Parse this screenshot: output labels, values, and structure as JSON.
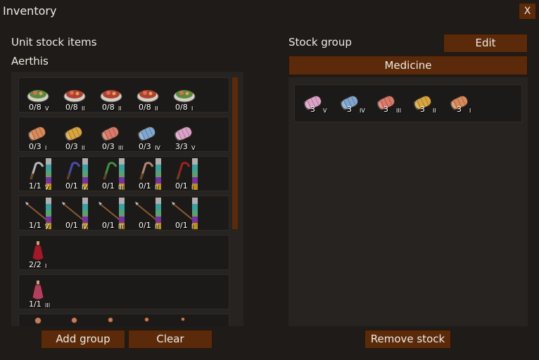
{
  "window": {
    "title": "Inventory",
    "close_label": "X"
  },
  "left": {
    "heading": "Unit stock items",
    "unit_name": "Aerthis",
    "rows": [
      {
        "kind": "food",
        "items": [
          {
            "icon": "salad-bowl-icon",
            "qty": "0/8",
            "rank": "V"
          },
          {
            "icon": "meat-bowl-icon",
            "qty": "0/8",
            "rank": "II"
          },
          {
            "icon": "meat-plate-icon",
            "qty": "0/8",
            "rank": "II"
          },
          {
            "icon": "meat-dish-icon",
            "qty": "0/8",
            "rank": "II"
          },
          {
            "icon": "salad-bowl-icon",
            "qty": "0/8",
            "rank": "I"
          }
        ]
      },
      {
        "kind": "bandage",
        "items": [
          {
            "icon": "bandage-roll-icon",
            "color": "#d98a5a",
            "qty": "0/3",
            "rank": "I"
          },
          {
            "icon": "bandage-roll-icon",
            "color": "#d8a640",
            "qty": "0/3",
            "rank": "II"
          },
          {
            "icon": "bandage-roll-icon",
            "color": "#d97a6a",
            "qty": "0/3",
            "rank": "III"
          },
          {
            "icon": "bandage-roll-icon",
            "color": "#7fa8d0",
            "qty": "0/3",
            "rank": "IV"
          },
          {
            "icon": "bandage-roll-icon",
            "color": "#dba2c8",
            "qty": "3/3",
            "rank": "V"
          }
        ]
      },
      {
        "kind": "sickle",
        "items": [
          {
            "icon": "sickle-icon",
            "color": "#b9b9b9",
            "qty": "1/1",
            "rank": "V"
          },
          {
            "icon": "sickle-icon",
            "color": "#4a4ab0",
            "qty": "0/1",
            "rank": "IV"
          },
          {
            "icon": "sickle-icon",
            "color": "#3f8f3f",
            "qty": "0/1",
            "rank": "III"
          },
          {
            "icon": "sickle-icon",
            "color": "#b08870",
            "qty": "0/1",
            "rank": "II"
          },
          {
            "icon": "sickle-icon",
            "color": "#a02020",
            "qty": "0/1",
            "rank": "I"
          }
        ]
      },
      {
        "kind": "spear",
        "items": [
          {
            "icon": "spear-icon",
            "qty": "1/1",
            "rank": "V"
          },
          {
            "icon": "spear-icon",
            "qty": "0/1",
            "rank": "IV"
          },
          {
            "icon": "spear-icon",
            "qty": "0/1",
            "rank": "III"
          },
          {
            "icon": "spear-icon",
            "qty": "0/1",
            "rank": "II"
          },
          {
            "icon": "spear-icon",
            "qty": "0/1",
            "rank": "I"
          }
        ]
      },
      {
        "kind": "potion",
        "items": [
          {
            "icon": "red-potion-icon",
            "qty": "2/2",
            "rank": "I"
          }
        ]
      },
      {
        "kind": "potion",
        "items": [
          {
            "icon": "pink-potion-icon",
            "qty": "1/1",
            "rank": "III"
          }
        ]
      }
    ],
    "add_group_label": "Add group",
    "clear_label": "Clear"
  },
  "right": {
    "heading": "Stock group",
    "edit_label": "Edit",
    "group_name": "Medicine",
    "items": [
      {
        "icon": "bandage-roll-icon",
        "color": "#dba2c8",
        "qty": "3",
        "rank": "V"
      },
      {
        "icon": "bandage-roll-icon",
        "color": "#7fa8d0",
        "qty": "3",
        "rank": "IV"
      },
      {
        "icon": "bandage-roll-icon",
        "color": "#d97a6a",
        "qty": "3",
        "rank": "III"
      },
      {
        "icon": "bandage-roll-icon",
        "color": "#d8a640",
        "qty": "3",
        "rank": "II"
      },
      {
        "icon": "bandage-roll-icon",
        "color": "#d98a5a",
        "qty": "3",
        "rank": "I"
      }
    ],
    "remove_label": "Remove stock"
  },
  "colors": {
    "button": "#5b2a0a",
    "panel": "#262320",
    "background": "#1e1b19",
    "slot": "#1c1a18"
  }
}
